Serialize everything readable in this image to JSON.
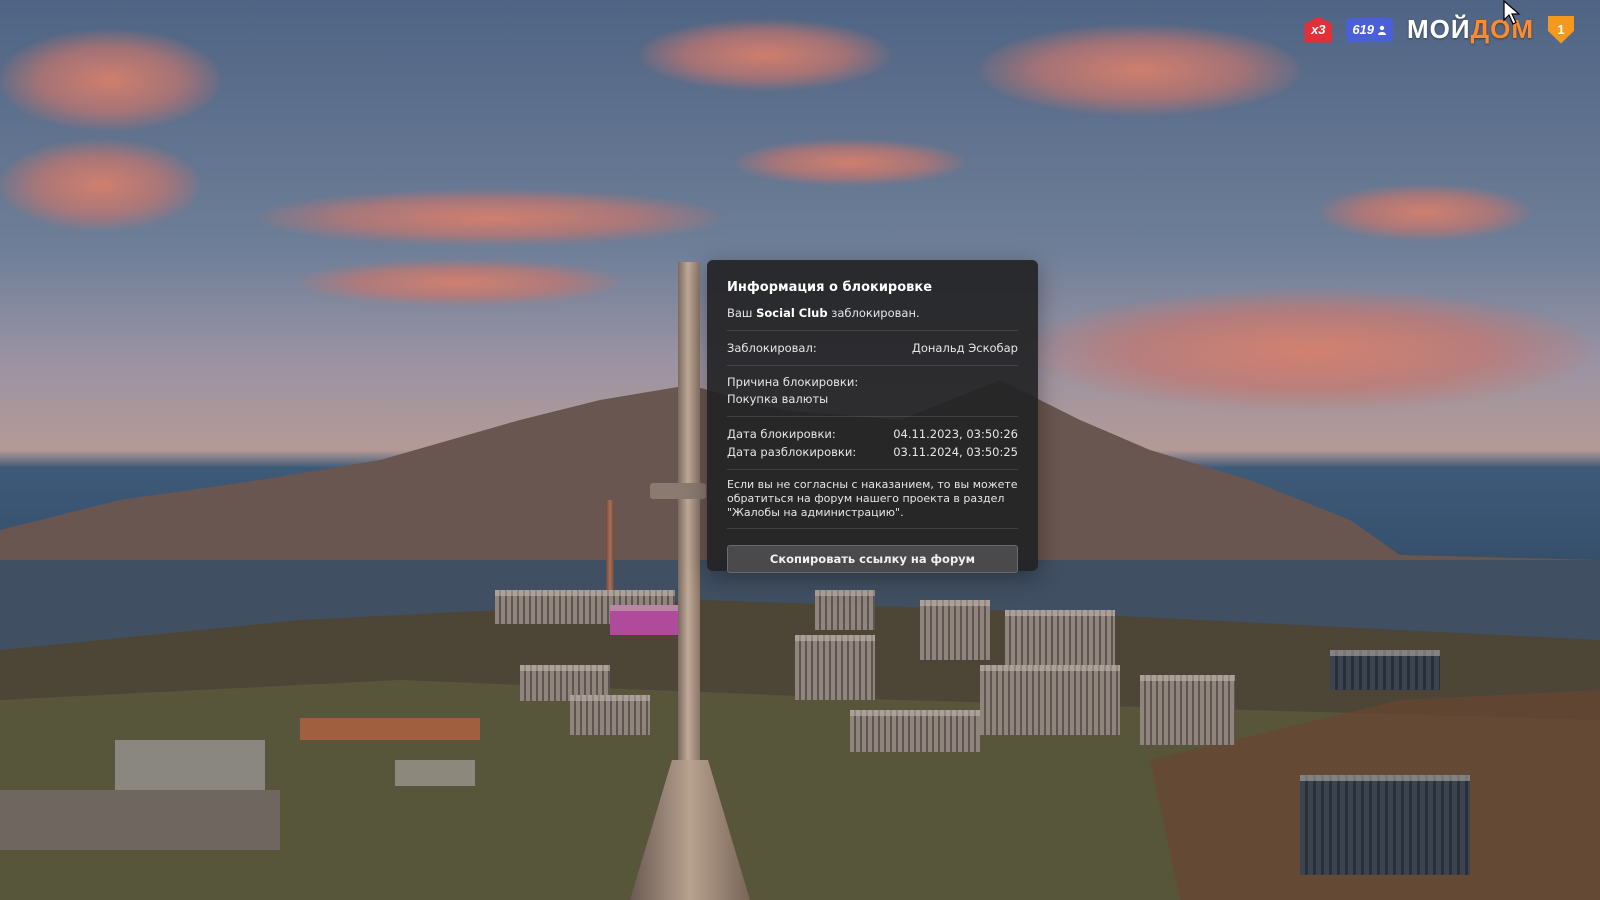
{
  "hud": {
    "multiplier": "x3",
    "online_count": "619",
    "logo_part1": "МОЙ",
    "logo_part2": "ДОМ",
    "level": "1"
  },
  "modal": {
    "title": "Информация о блокировке",
    "message_prefix": "Ваш",
    "message_highlight": "Social Club",
    "message_suffix": "заблокирован.",
    "banned_by_label": "Заблокировал:",
    "banned_by_value": "Дональд Эскобар",
    "reason_label": "Причина блокировки:",
    "reason_value": "Покупка валюты",
    "ban_date_label": "Дата блокировки:",
    "ban_date_value": "04.11.2023, 03:50:26",
    "unban_date_label": "Дата разблокировки:",
    "unban_date_value": "03.11.2024, 03:50:25",
    "appeal_text": "Если вы не согласны с наказанием, то вы можете обратиться на форум нашего проекта в раздел \"Жалобы на администрацию\".",
    "copy_button": "Скопировать ссылку на форум"
  },
  "colors": {
    "multiplier_badge": "#e0303a",
    "online_badge": "#4a5fd8",
    "level_badge": "#f39a1e",
    "modal_bg": "#242426"
  },
  "icons": {
    "cursor": "mouse-pointer-icon",
    "online": "users-icon",
    "level": "shield-icon"
  }
}
